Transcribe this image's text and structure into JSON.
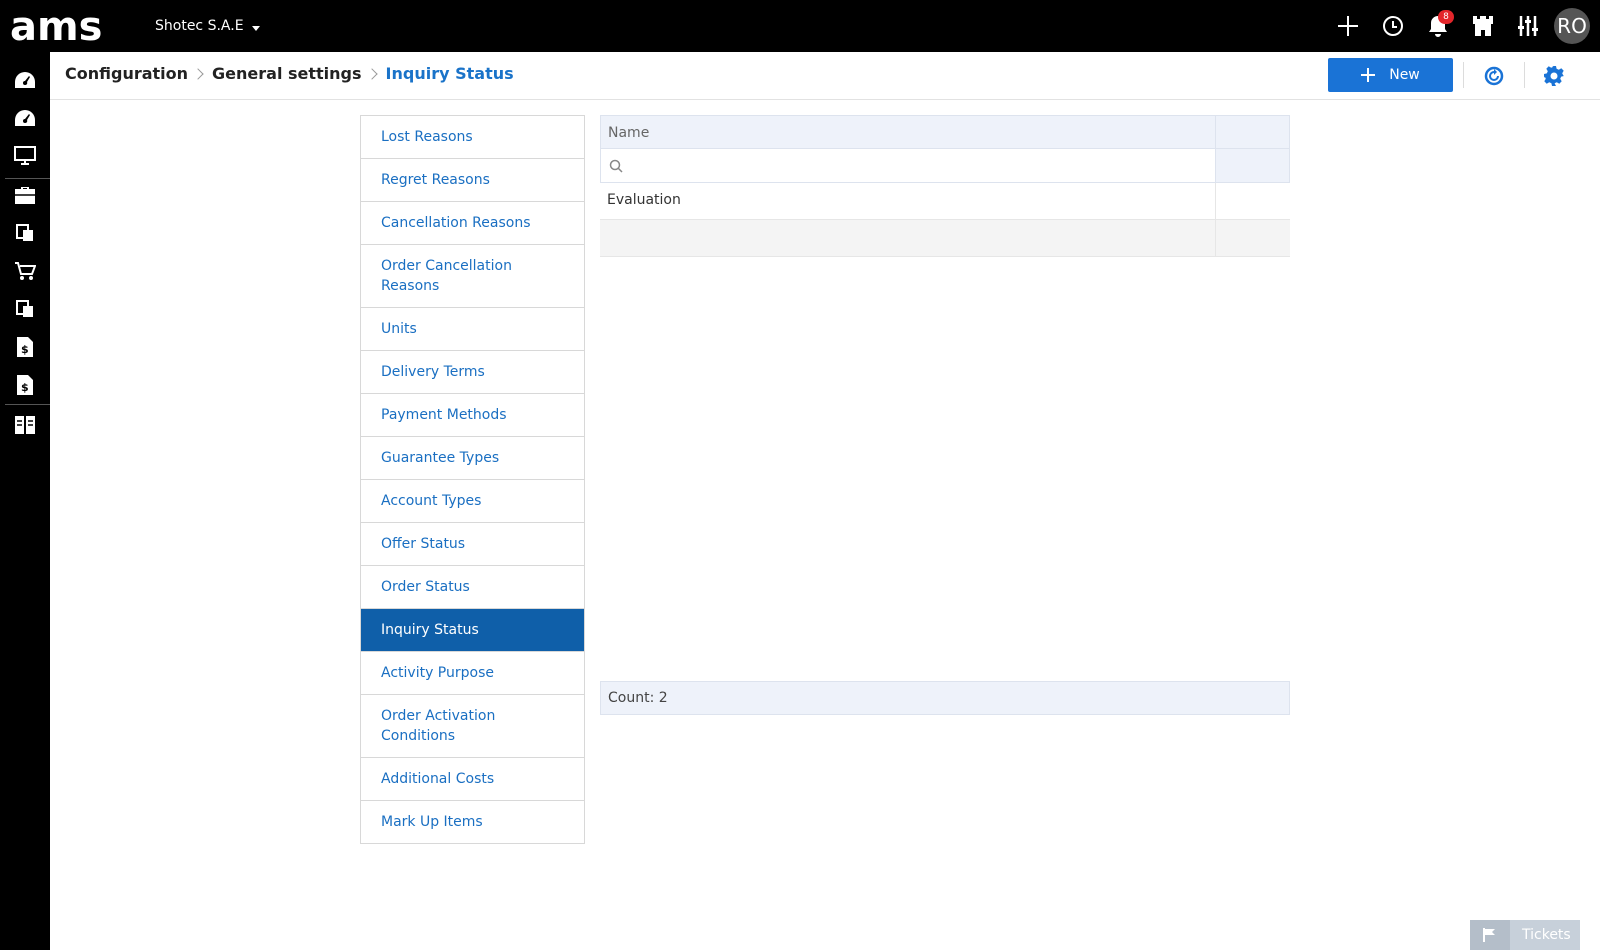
{
  "app": {
    "company": "Shotec S.A.E",
    "notifications_count": "8",
    "user_initials": "RO"
  },
  "breadcrumb": [
    "Configuration",
    "General settings",
    "Inquiry Status"
  ],
  "toolbar": {
    "new_label": "New"
  },
  "settings_nav": [
    "Lost Reasons",
    "Regret Reasons",
    "Cancellation Reasons",
    "Order Cancellation Reasons",
    "Units",
    "Delivery Terms",
    "Payment Methods",
    "Guarantee Types",
    "Account Types",
    "Offer Status",
    "Order Status",
    "Inquiry Status",
    "Activity Purpose",
    "Order Activation Conditions",
    "Additional Costs",
    "Mark Up Items"
  ],
  "selected_nav": "Inquiry Status",
  "grid": {
    "column_name": "Name",
    "filter_value": "",
    "rows": [
      "Evaluation",
      ""
    ],
    "footer": "Count: 2"
  },
  "tickets_label": "Tickets",
  "colors": {
    "accent": "#1a73d6",
    "selected": "#0f5fa9",
    "link": "#1a6fc2"
  },
  "icons": {
    "top": [
      "plus-icon",
      "history-icon",
      "bell-icon",
      "castle-icon",
      "sliders-icon"
    ],
    "sidebar": [
      "dashboard-icon",
      "dashboard-alt-icon",
      "monitor-icon",
      "briefcase-icon",
      "documents-icon",
      "cart-icon",
      "documents-alt-icon",
      "invoice-icon",
      "invoice-alt-icon",
      "reports-icon"
    ],
    "header": [
      "refresh-icon",
      "gear-icon"
    ]
  }
}
